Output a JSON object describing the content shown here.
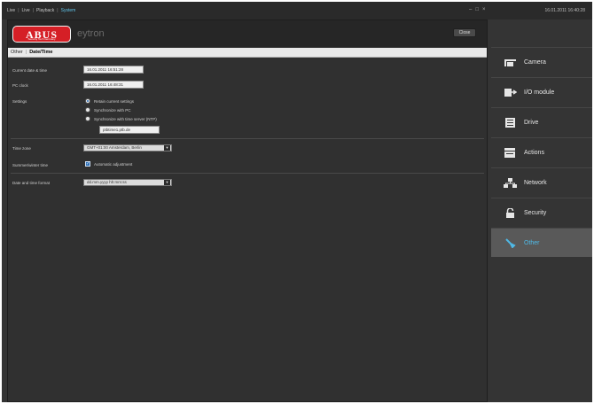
{
  "topbar": {
    "nav": [
      "Live",
      "Live",
      "Playback",
      "System"
    ],
    "active_index": 3,
    "window_controls": [
      "minimize-icon",
      "maximize-icon",
      "close-icon"
    ],
    "clock": "16.01.2011 16:40:28"
  },
  "dialog": {
    "logo_text": "ABUS",
    "logo_tagline": "Security Tech Germany",
    "product_name": "eytron",
    "close_label": "Close",
    "breadcrumb": [
      "Other",
      "Date/Time"
    ],
    "fields": {
      "current_date_label": "Current date & time",
      "current_date_value": "16.01.2011 16:51:28",
      "pc_clock_label": "PC clock",
      "pc_clock_value": "16.01.2011 16:48:31",
      "settings_label": "Settings"
    },
    "radio_options": [
      {
        "label": "Retain current settings",
        "selected": true
      },
      {
        "label": "Synchronize with PC",
        "selected": false
      },
      {
        "label": "Synchronize with time server (NTP)",
        "selected": false
      }
    ],
    "ntp_server": "ptbtime1.ptb.de",
    "time_zone_label": "Time zone",
    "time_zone_value": "GMT+01:00 Amsterdam, Berlin",
    "dst_label": "Summer/winter time",
    "dst_checkbox_label": "Automatic adjustment",
    "date_format_label": "Date and time format",
    "date_format_value": "dd.mm.yyyy hh:mm:ss"
  },
  "sidebar": {
    "items": [
      {
        "label": "Camera",
        "icon": "camera-icon",
        "active": false
      },
      {
        "label": "I/O module",
        "icon": "io-module-icon",
        "active": false
      },
      {
        "label": "Drive",
        "icon": "drive-icon",
        "active": false
      },
      {
        "label": "Actions",
        "icon": "actions-icon",
        "active": false
      },
      {
        "label": "Network",
        "icon": "network-icon",
        "active": false
      },
      {
        "label": "Security",
        "icon": "lock-icon",
        "active": false
      },
      {
        "label": "Other",
        "icon": "wrench-icon",
        "active": true
      }
    ]
  },
  "colors": {
    "accent": "#4fb9e6",
    "brand_red": "#d51f26",
    "background": "#343434"
  }
}
